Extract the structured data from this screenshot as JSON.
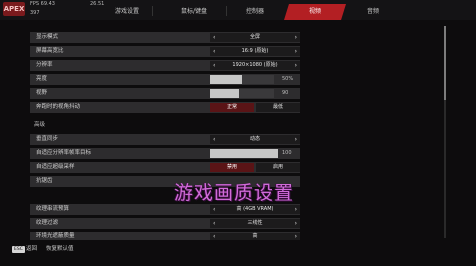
{
  "hud": {
    "logo": "APEX",
    "stats": [
      "FPS 69.43",
      "26.51",
      "397"
    ]
  },
  "tabs": [
    {
      "label": "游戏设置",
      "active": false
    },
    {
      "label": "鼠标/键盘",
      "active": false
    },
    {
      "label": "控制器",
      "active": false
    },
    {
      "label": "视频",
      "active": true
    },
    {
      "label": "音频",
      "active": false
    }
  ],
  "settings": {
    "display_mode": {
      "label": "显示模式",
      "value": "全屏"
    },
    "aspect_ratio": {
      "label": "屏幕高宽比",
      "value": "16:9 (原始)"
    },
    "resolution": {
      "label": "分辨率",
      "value": "1920×1080 (原始)"
    },
    "brightness": {
      "label": "亮度",
      "value_text": "50%",
      "fill": 0.5
    },
    "fov": {
      "label": "视野",
      "value_text": "90",
      "fill": 0.45
    },
    "sprint_shake": {
      "label": "奔跑时的视角抖动",
      "options": [
        "正常",
        "最低"
      ],
      "selected": 0
    },
    "section_advanced": "高级",
    "vsync": {
      "label": "垂直同步",
      "value": "动态"
    },
    "adaptive_target": {
      "label": "自适应分辨率帧率目标",
      "value_text": "100",
      "fill": 1.0
    },
    "adaptive_supersample": {
      "label": "自适应超级采样",
      "options": [
        "禁用",
        "启用"
      ],
      "selected": 0
    },
    "antialiasing": {
      "label": "抗锯齿"
    },
    "texture_budget": {
      "label": "纹理串流预算",
      "value": "高 (4GB VRAM)"
    },
    "texture_filter": {
      "label": "纹理过滤",
      "value": "三线性"
    },
    "ambient_occlusion": {
      "label": "环境光遮蔽质量",
      "value": "高"
    }
  },
  "overlay_text": "游戏画质设置",
  "footer": {
    "esc_key": "ESC",
    "back_label": "返回",
    "reset_label": "恢复默认值"
  },
  "colors": {
    "accent": "#b31f23",
    "overlay": "#d06bd8"
  }
}
